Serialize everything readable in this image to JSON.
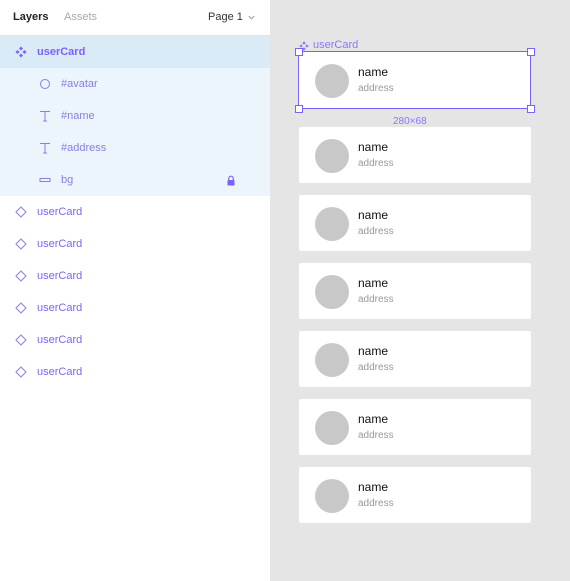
{
  "panel": {
    "tabs": {
      "layers": "Layers",
      "assets": "Assets"
    },
    "page_selector": "Page 1"
  },
  "layers": [
    {
      "label": "userCard",
      "icon": "component-icon",
      "state": "selected"
    },
    {
      "label": "#avatar",
      "icon": "ellipse-icon",
      "state": "child"
    },
    {
      "label": "#name",
      "icon": "text-icon",
      "state": "child"
    },
    {
      "label": "#address",
      "icon": "text-icon",
      "state": "child"
    },
    {
      "label": "bg",
      "icon": "rectangle-icon",
      "state": "child",
      "locked": true
    },
    {
      "label": "userCard",
      "icon": "instance-icon",
      "state": "normal"
    },
    {
      "label": "userCard",
      "icon": "instance-icon",
      "state": "normal"
    },
    {
      "label": "userCard",
      "icon": "instance-icon",
      "state": "normal"
    },
    {
      "label": "userCard",
      "icon": "instance-icon",
      "state": "normal"
    },
    {
      "label": "userCard",
      "icon": "instance-icon",
      "state": "normal"
    },
    {
      "label": "userCard",
      "icon": "instance-icon",
      "state": "normal"
    }
  ],
  "canvas": {
    "frame_label": "userCard",
    "size_label": "280×68",
    "cards": [
      {
        "name": "name",
        "address": "address"
      },
      {
        "name": "name",
        "address": "address"
      },
      {
        "name": "name",
        "address": "address"
      },
      {
        "name": "name",
        "address": "address"
      },
      {
        "name": "name",
        "address": "address"
      },
      {
        "name": "name",
        "address": "address"
      },
      {
        "name": "name",
        "address": "address"
      }
    ]
  },
  "colors": {
    "accent": "#7b61ff",
    "selected_row": "#daebf7",
    "child_row": "#edf5fc",
    "canvas_bg": "#e5e5e5",
    "avatar": "#c8c8c8"
  }
}
